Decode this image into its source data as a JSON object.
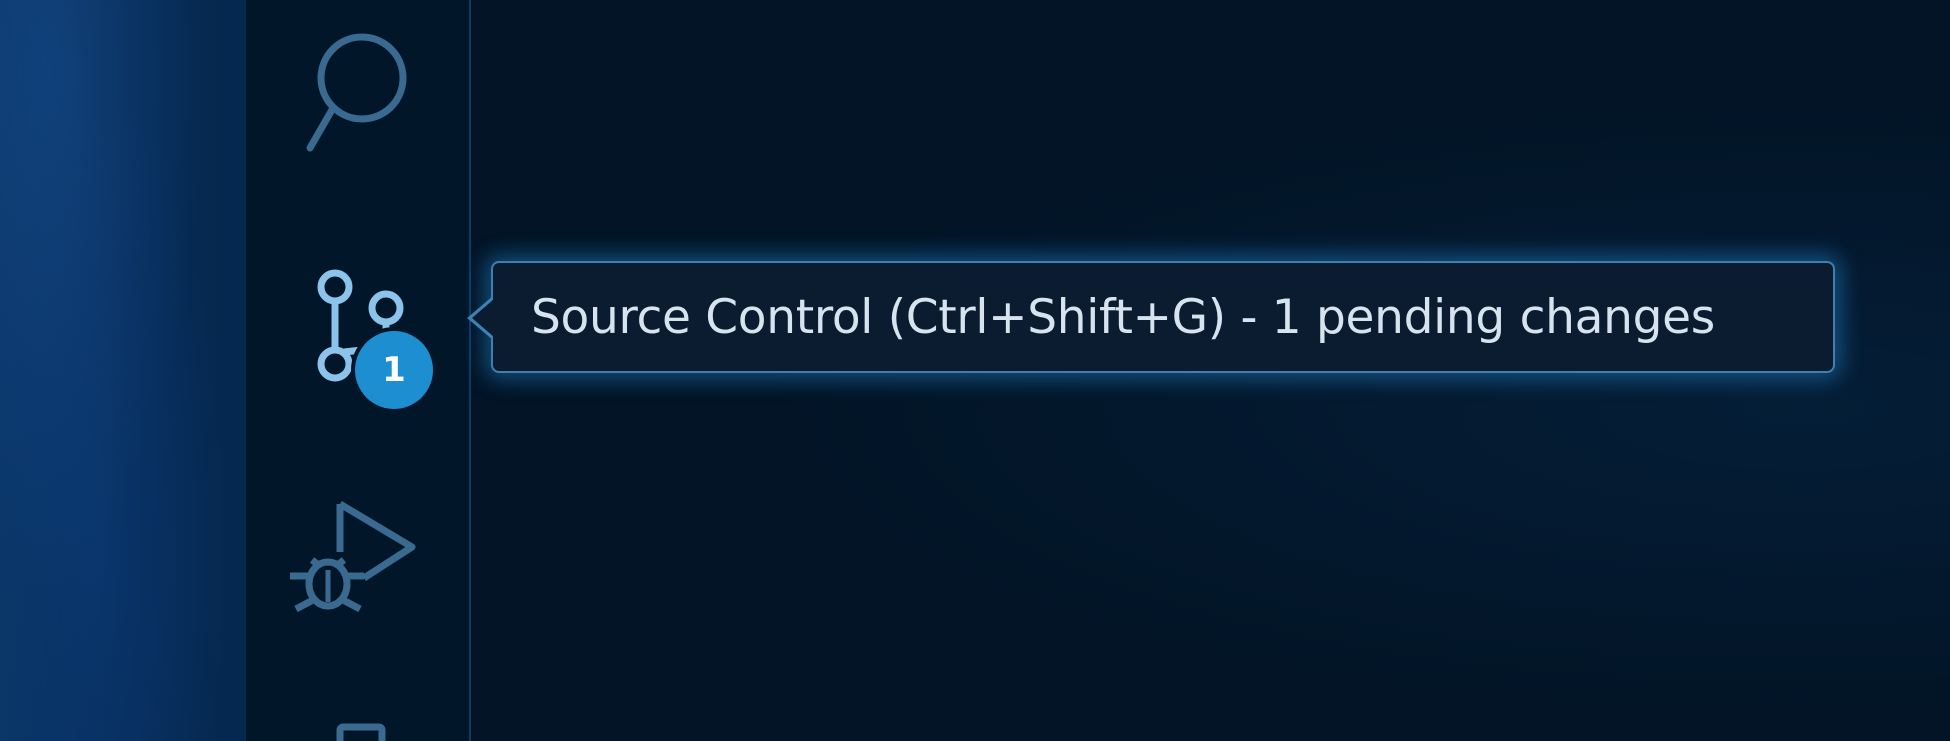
{
  "activity_bar": {
    "items": [
      {
        "id": "search",
        "icon": "search-icon"
      },
      {
        "id": "source-control",
        "icon": "source-control-icon",
        "badge": "1"
      },
      {
        "id": "run-debug",
        "icon": "run-debug-icon"
      },
      {
        "id": "extensions",
        "icon": "extensions-icon"
      }
    ]
  },
  "tooltip": {
    "text": "Source Control (Ctrl+Shift+G) - 1 pending changes"
  },
  "colors": {
    "background": "#021426",
    "activity_bar": "#021629",
    "icon_inactive": "#3a6a8f",
    "icon_active": "#8cc3ea",
    "badge": "#1d8fd0",
    "tooltip_border": "#3f7fb0",
    "tooltip_text": "#d7e3ee"
  }
}
